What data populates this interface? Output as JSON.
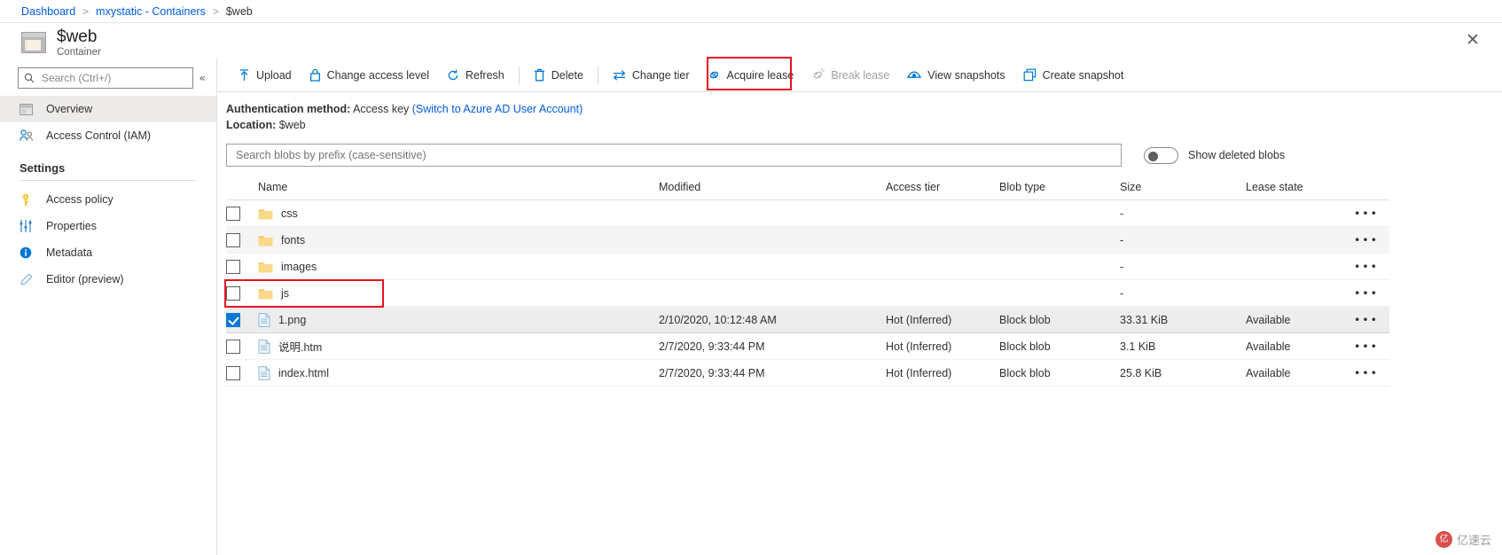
{
  "breadcrumb": {
    "items": [
      {
        "label": "Dashboard",
        "link": true
      },
      {
        "label": "mxystatic - Containers",
        "link": true
      },
      {
        "label": "$web",
        "link": false
      }
    ],
    "separator": ">"
  },
  "header": {
    "title": "$web",
    "subtitle": "Container",
    "close_label": "✕"
  },
  "sidebar": {
    "search": {
      "placeholder": "Search (Ctrl+/)",
      "value": ""
    },
    "collapse_label": "«",
    "items": [
      {
        "label": "Overview",
        "icon": "overview-icon",
        "selected": true
      },
      {
        "label": "Access Control (IAM)",
        "icon": "people-icon",
        "selected": false
      }
    ],
    "section_label": "Settings",
    "settings_items": [
      {
        "label": "Access policy",
        "icon": "key-icon"
      },
      {
        "label": "Properties",
        "icon": "sliders-icon"
      },
      {
        "label": "Metadata",
        "icon": "info-icon"
      },
      {
        "label": "Editor (preview)",
        "icon": "pencil-icon"
      }
    ]
  },
  "toolbar": {
    "buttons": [
      {
        "label": "Upload",
        "icon": "upload-icon",
        "disabled": false
      },
      {
        "label": "Change access level",
        "icon": "lock-icon",
        "disabled": false
      },
      {
        "label": "Refresh",
        "icon": "refresh-icon",
        "disabled": false
      },
      {
        "label": "Delete",
        "icon": "trash-icon",
        "disabled": false,
        "highlighted": true
      },
      {
        "label": "Change tier",
        "icon": "swap-icon",
        "disabled": false
      },
      {
        "label": "Acquire lease",
        "icon": "link-icon",
        "disabled": false
      },
      {
        "label": "Break lease",
        "icon": "broken-link-icon",
        "disabled": true
      },
      {
        "label": "View snapshots",
        "icon": "eye-icon",
        "disabled": false
      },
      {
        "label": "Create snapshot",
        "icon": "copy-icon",
        "disabled": false
      }
    ]
  },
  "auth": {
    "method_label": "Authentication method:",
    "method_value": "Access key",
    "switch_link": "(Switch to Azure AD User Account)",
    "location_label": "Location:",
    "location_value": "$web"
  },
  "filter": {
    "search_placeholder": "Search blobs by prefix (case-sensitive)",
    "search_value": "",
    "toggle_label": "Show deleted blobs",
    "toggle_on": false
  },
  "table": {
    "headers": [
      "Name",
      "Modified",
      "Access tier",
      "Blob type",
      "Size",
      "Lease state"
    ],
    "menu_glyph": "•••",
    "rows": [
      {
        "name": "css",
        "kind": "folder",
        "checked": false,
        "modified": "",
        "tier": "",
        "type": "",
        "size": "-",
        "lease": ""
      },
      {
        "name": "fonts",
        "kind": "folder",
        "checked": false,
        "modified": "",
        "tier": "",
        "type": "",
        "size": "-",
        "lease": ""
      },
      {
        "name": "images",
        "kind": "folder",
        "checked": false,
        "modified": "",
        "tier": "",
        "type": "",
        "size": "-",
        "lease": ""
      },
      {
        "name": "js",
        "kind": "folder",
        "checked": false,
        "modified": "",
        "tier": "",
        "type": "",
        "size": "-",
        "lease": ""
      },
      {
        "name": "1.png",
        "kind": "file",
        "checked": true,
        "modified": "2/10/2020, 10:12:48 AM",
        "tier": "Hot (Inferred)",
        "type": "Block blob",
        "size": "33.31 KiB",
        "lease": "Available"
      },
      {
        "name": "说明.htm",
        "kind": "file",
        "checked": false,
        "modified": "2/7/2020, 9:33:44 PM",
        "tier": "Hot (Inferred)",
        "type": "Block blob",
        "size": "3.1 KiB",
        "lease": "Available"
      },
      {
        "name": "index.html",
        "kind": "file",
        "checked": false,
        "modified": "2/7/2020, 9:33:44 PM",
        "tier": "Hot (Inferred)",
        "type": "Block blob",
        "size": "25.8 KiB",
        "lease": "Available"
      }
    ]
  },
  "watermark": {
    "badge": "亿",
    "text": "亿速云"
  },
  "colors": {
    "accent": "#0078d4",
    "link": "#015cda",
    "highlight": "#e81123",
    "folder": "#f5c969",
    "selected_row": "#ededed"
  }
}
